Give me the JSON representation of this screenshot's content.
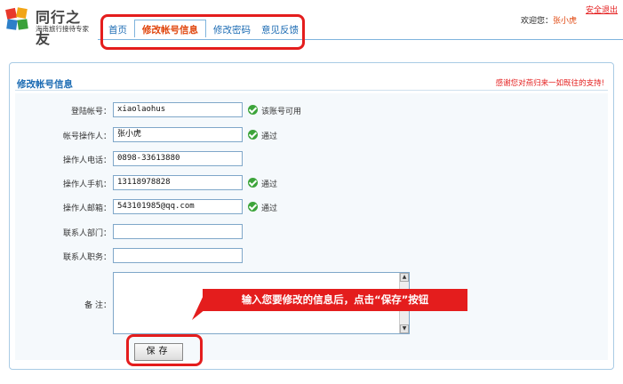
{
  "logo": {
    "title": "同行之友",
    "subtitle": "海南旅行接待专家"
  },
  "nav": {
    "tabs": [
      {
        "label": "首页"
      },
      {
        "label": "修改帐号信息",
        "active": true
      },
      {
        "label": "修改密码"
      },
      {
        "label": "意见反馈"
      }
    ]
  },
  "header": {
    "logout": "安全退出",
    "welcome": "欢迎您：",
    "username": "张小虎"
  },
  "panel": {
    "title": "修改帐号信息",
    "thanks": "感谢您对燕归来一如既往的支持!"
  },
  "form": {
    "rows": [
      {
        "label": "登陆帐号：",
        "value": "xiaolaohus",
        "status": "该账号可用"
      },
      {
        "label": "帐号操作人：",
        "value": "张小虎",
        "status": "通过"
      },
      {
        "label": "操作人电话：",
        "value": "0898-33613880",
        "status": ""
      },
      {
        "label": "操作人手机：",
        "value": "13118978828",
        "status": "通过"
      },
      {
        "label": "操作人邮箱：",
        "value": "543101985@qq.com",
        "status": "通过"
      },
      {
        "label": "联系人部门：",
        "value": "",
        "status": ""
      },
      {
        "label": "联系人职务：",
        "value": "",
        "status": ""
      }
    ],
    "remark_label": "备  注：",
    "remark_value": "",
    "save_label": "保存"
  },
  "callout": {
    "text": "输入您要修改的信息后，点击“保存”按钮"
  },
  "colors": {
    "accent_red": "#e41d1d",
    "link_blue": "#1b6bb3",
    "check_green": "#3ca43a"
  }
}
